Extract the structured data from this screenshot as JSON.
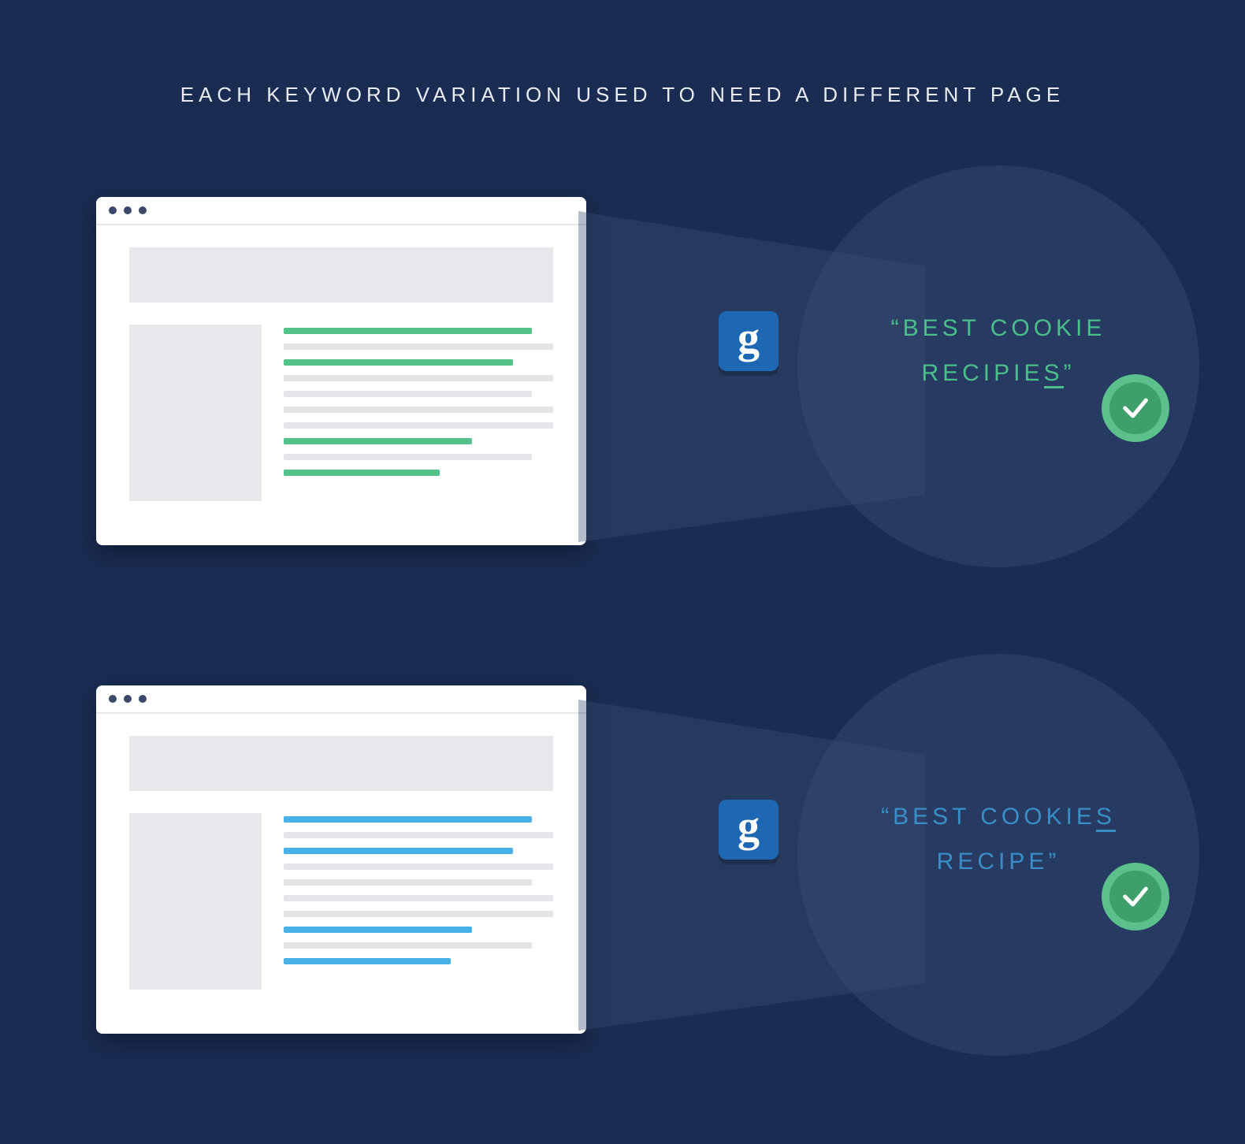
{
  "title": "EACH KEYWORD VARIATION USED TO NEED A DIFFERENT PAGE",
  "badge_letter": "g",
  "cards": [
    {
      "keyword_line1": "“BEST COOKIE",
      "keyword_line2_pre": "RECIPIE",
      "keyword_line2_underlined": "S",
      "keyword_line2_post": "”",
      "highlight_color": "green"
    },
    {
      "keyword_line1_pre": "“BEST COOKIE",
      "keyword_line1_underlined": "S",
      "keyword_line2": "RECIPE”",
      "highlight_color": "blue"
    }
  ]
}
